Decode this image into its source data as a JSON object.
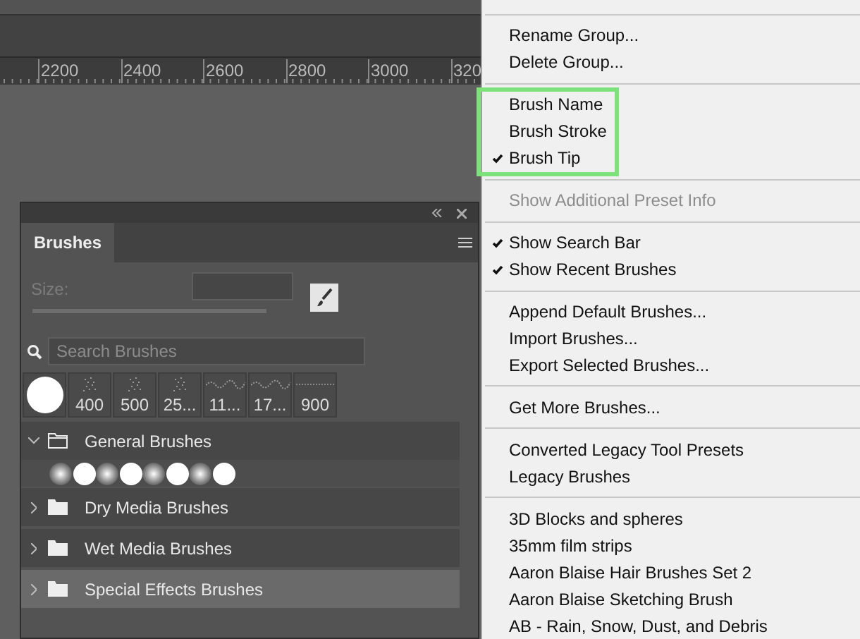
{
  "ruler": {
    "labels": [
      "2200",
      "2400",
      "2600",
      "2800",
      "3000",
      "320"
    ]
  },
  "panel": {
    "tab": {
      "label": "Brushes",
      "selected": true
    },
    "size": {
      "label": "Size:",
      "disabled": true
    },
    "search": {
      "placeholder": "Search Brushes"
    },
    "presets": [
      {
        "kind": "round"
      },
      {
        "kind": "spatter",
        "label": "400"
      },
      {
        "kind": "spatter",
        "label": "500"
      },
      {
        "kind": "spatter",
        "label": "25..."
      },
      {
        "kind": "grass",
        "label": "11..."
      },
      {
        "kind": "grass",
        "label": "17..."
      },
      {
        "kind": "line",
        "label": "900"
      }
    ],
    "groups": [
      {
        "name": "General Brushes",
        "expanded": true,
        "selected": false,
        "tips": [
          {
            "kind": "soft"
          },
          {
            "kind": "hard"
          },
          {
            "kind": "soft"
          },
          {
            "kind": "hard"
          },
          {
            "kind": "soft"
          },
          {
            "kind": "hard"
          },
          {
            "kind": "soft"
          },
          {
            "kind": "hard"
          }
        ]
      },
      {
        "name": "Dry Media Brushes",
        "expanded": false,
        "selected": false
      },
      {
        "name": "Wet Media Brushes",
        "expanded": false,
        "selected": false
      },
      {
        "name": "Special Effects Brushes",
        "expanded": false,
        "selected": true
      }
    ]
  },
  "menu": {
    "sections": [
      {
        "highlighted": false,
        "items": [
          {
            "label": "Rename Group...",
            "checked": false,
            "disabled": false
          },
          {
            "label": "Delete Group...",
            "checked": false,
            "disabled": false
          }
        ]
      },
      {
        "highlighted": true,
        "items": [
          {
            "label": "Brush Name",
            "checked": false,
            "disabled": false
          },
          {
            "label": "Brush Stroke",
            "checked": false,
            "disabled": false
          },
          {
            "label": "Brush Tip",
            "checked": true,
            "disabled": false
          }
        ]
      },
      {
        "highlighted": false,
        "items": [
          {
            "label": "Show Additional Preset Info",
            "checked": false,
            "disabled": true
          }
        ]
      },
      {
        "highlighted": false,
        "items": [
          {
            "label": "Show Search Bar",
            "checked": true,
            "disabled": false
          },
          {
            "label": "Show Recent Brushes",
            "checked": true,
            "disabled": false
          }
        ]
      },
      {
        "highlighted": false,
        "items": [
          {
            "label": "Append Default Brushes...",
            "checked": false,
            "disabled": false
          },
          {
            "label": "Import Brushes...",
            "checked": false,
            "disabled": false
          },
          {
            "label": "Export Selected Brushes...",
            "checked": false,
            "disabled": false
          }
        ]
      },
      {
        "highlighted": false,
        "items": [
          {
            "label": "Get More Brushes...",
            "checked": false,
            "disabled": false
          }
        ]
      },
      {
        "highlighted": false,
        "items": [
          {
            "label": "Converted Legacy Tool Presets",
            "checked": false,
            "disabled": false
          },
          {
            "label": "Legacy Brushes",
            "checked": false,
            "disabled": false
          }
        ]
      },
      {
        "highlighted": false,
        "items": [
          {
            "label": "3D Blocks and spheres",
            "checked": false,
            "disabled": false
          },
          {
            "label": "35mm film strips",
            "checked": false,
            "disabled": false
          },
          {
            "label": "Aaron Blaise Hair Brushes Set 2",
            "checked": false,
            "disabled": false
          },
          {
            "label": "Aaron Blaise Sketching Brush",
            "checked": false,
            "disabled": false
          },
          {
            "label": "AB - Rain, Snow, Dust, and Debris",
            "checked": false,
            "disabled": false
          }
        ]
      }
    ]
  }
}
